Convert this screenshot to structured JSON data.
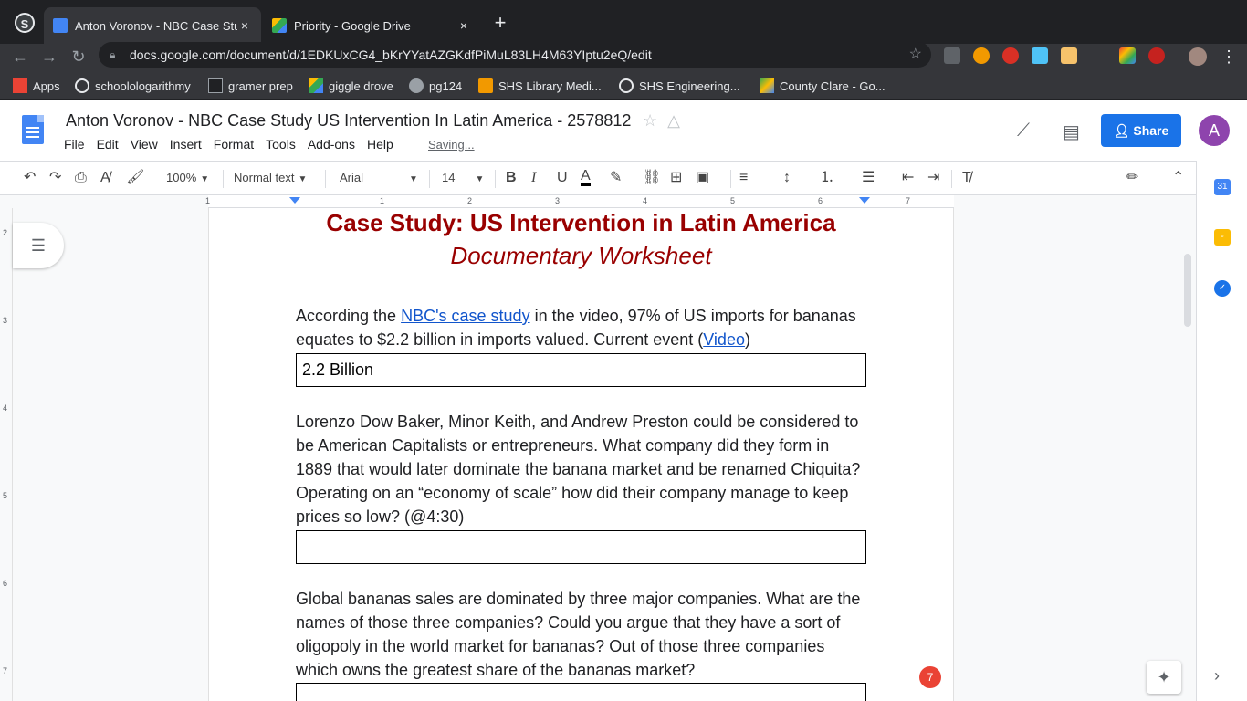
{
  "browser": {
    "tabs": [
      {
        "label": "Anton Voronov - NBC Case Stu",
        "close": "×"
      },
      {
        "label": "Priority - Google Drive",
        "close": "×"
      }
    ],
    "new_tab": "+",
    "url": "docs.google.com/document/d/1EDKUxCG4_bKrYYatAZGKdfPiMuL83LH4M63YIptu2eQ/edit"
  },
  "bookmarks": [
    {
      "label": "Apps",
      "color": "#ea4335"
    },
    {
      "label": "schoolologarithmy",
      "color": "#5f6368"
    },
    {
      "label": "gramer prep",
      "color": "#202124"
    },
    {
      "label": "giggle drove",
      "color": "#fbbc04"
    },
    {
      "label": "pg124",
      "color": "#9aa0a6"
    },
    {
      "label": "SHS Library Medi...",
      "color": "#f29900"
    },
    {
      "label": "SHS Engineering...",
      "color": "#5f6368"
    },
    {
      "label": "County Clare - Go...",
      "color": "#34a853"
    }
  ],
  "docs": {
    "title": "Anton Voronov - NBC Case Study US Intervention In Latin America - 2578812",
    "menu": [
      "File",
      "Edit",
      "View",
      "Insert",
      "Format",
      "Tools",
      "Add-ons",
      "Help"
    ],
    "status": "Saving...",
    "share_label": "Share",
    "avatar_letter": "A"
  },
  "toolbar": {
    "zoom": "100%",
    "style": "Normal text",
    "font": "Arial",
    "size": "14"
  },
  "document": {
    "heading": "Case Study: US Intervention in Latin America",
    "subheading": "Documentary Worksheet",
    "q1": {
      "pre": "According the ",
      "link": "NBC's case study",
      "mid": " in the video, 97% of US imports for bananas equates to  $2.2 billion in imports valued. Current event (",
      "link2": "Video",
      "post": ")"
    },
    "a1": "2.2 Billion",
    "q2": "Lorenzo Dow Baker,  Minor Keith, and Andrew Preston could be considered to be American Capitalists or entrepreneurs. What company did they form in 1889 that would later dominate the banana market and be renamed Chiquita? Operating on an “economy of scale” how did their company manage to keep prices so low? (@4:30)",
    "a2": "",
    "q3": "Global bananas sales are dominated by three major companies. What are the names of those three companies? Could you argue that they have a sort of oligopoly in the world market for bananas? Out of those three companies which owns the greatest share of the bananas market?",
    "a3": ""
  },
  "notification_count": "7",
  "colors": {
    "accent": "#1a73e8",
    "heading": "#990000",
    "link": "#1155cc"
  }
}
